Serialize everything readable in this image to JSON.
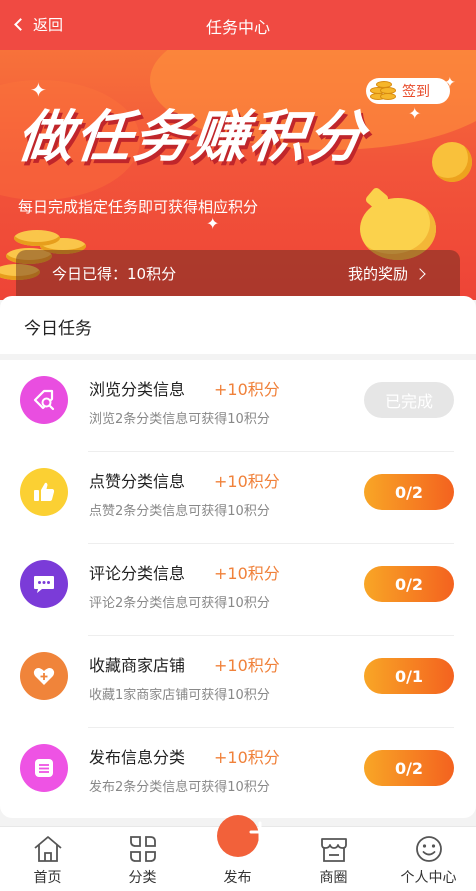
{
  "navbar": {
    "back_label": "返回",
    "title": "任务中心"
  },
  "banner": {
    "headline": "做任务赚积分",
    "subtitle": "每日完成指定任务即可获得相应积分",
    "signin_label": "签到"
  },
  "reward_bar": {
    "today_label": "今日已得：10积分",
    "link_label": "我的奖励"
  },
  "tasks_section": {
    "title": "今日任务"
  },
  "tasks": [
    {
      "title": "浏览分类信息",
      "points": "+10积分",
      "desc": "浏览2条分类信息可获得10积分",
      "status": "已完成",
      "icon": "tag-search-icon",
      "color": "#e94ee0"
    },
    {
      "title": "点赞分类信息",
      "points": "+10积分",
      "desc": "点赞2条分类信息可获得10积分",
      "status": "0/2",
      "icon": "thumbs-up-icon",
      "color": "#fbd033"
    },
    {
      "title": "评论分类信息",
      "points": "+10积分",
      "desc": "评论2条分类信息可获得10积分",
      "status": "0/2",
      "icon": "comment-icon",
      "color": "#7b3bd8"
    },
    {
      "title": "收藏商家店铺",
      "points": "+10积分",
      "desc": "收藏1家商家店铺可获得10积分",
      "status": "0/1",
      "icon": "heart-icon",
      "color": "#f0843a"
    },
    {
      "title": "发布信息分类",
      "points": "+10积分",
      "desc": "发布2条分类信息可获得10积分",
      "status": "0/2",
      "icon": "publish-list-icon",
      "color": "#ee53e4"
    }
  ],
  "tabbar": {
    "home": "首页",
    "category": "分类",
    "publish": "发布",
    "mall": "商圈",
    "profile": "个人中心"
  }
}
